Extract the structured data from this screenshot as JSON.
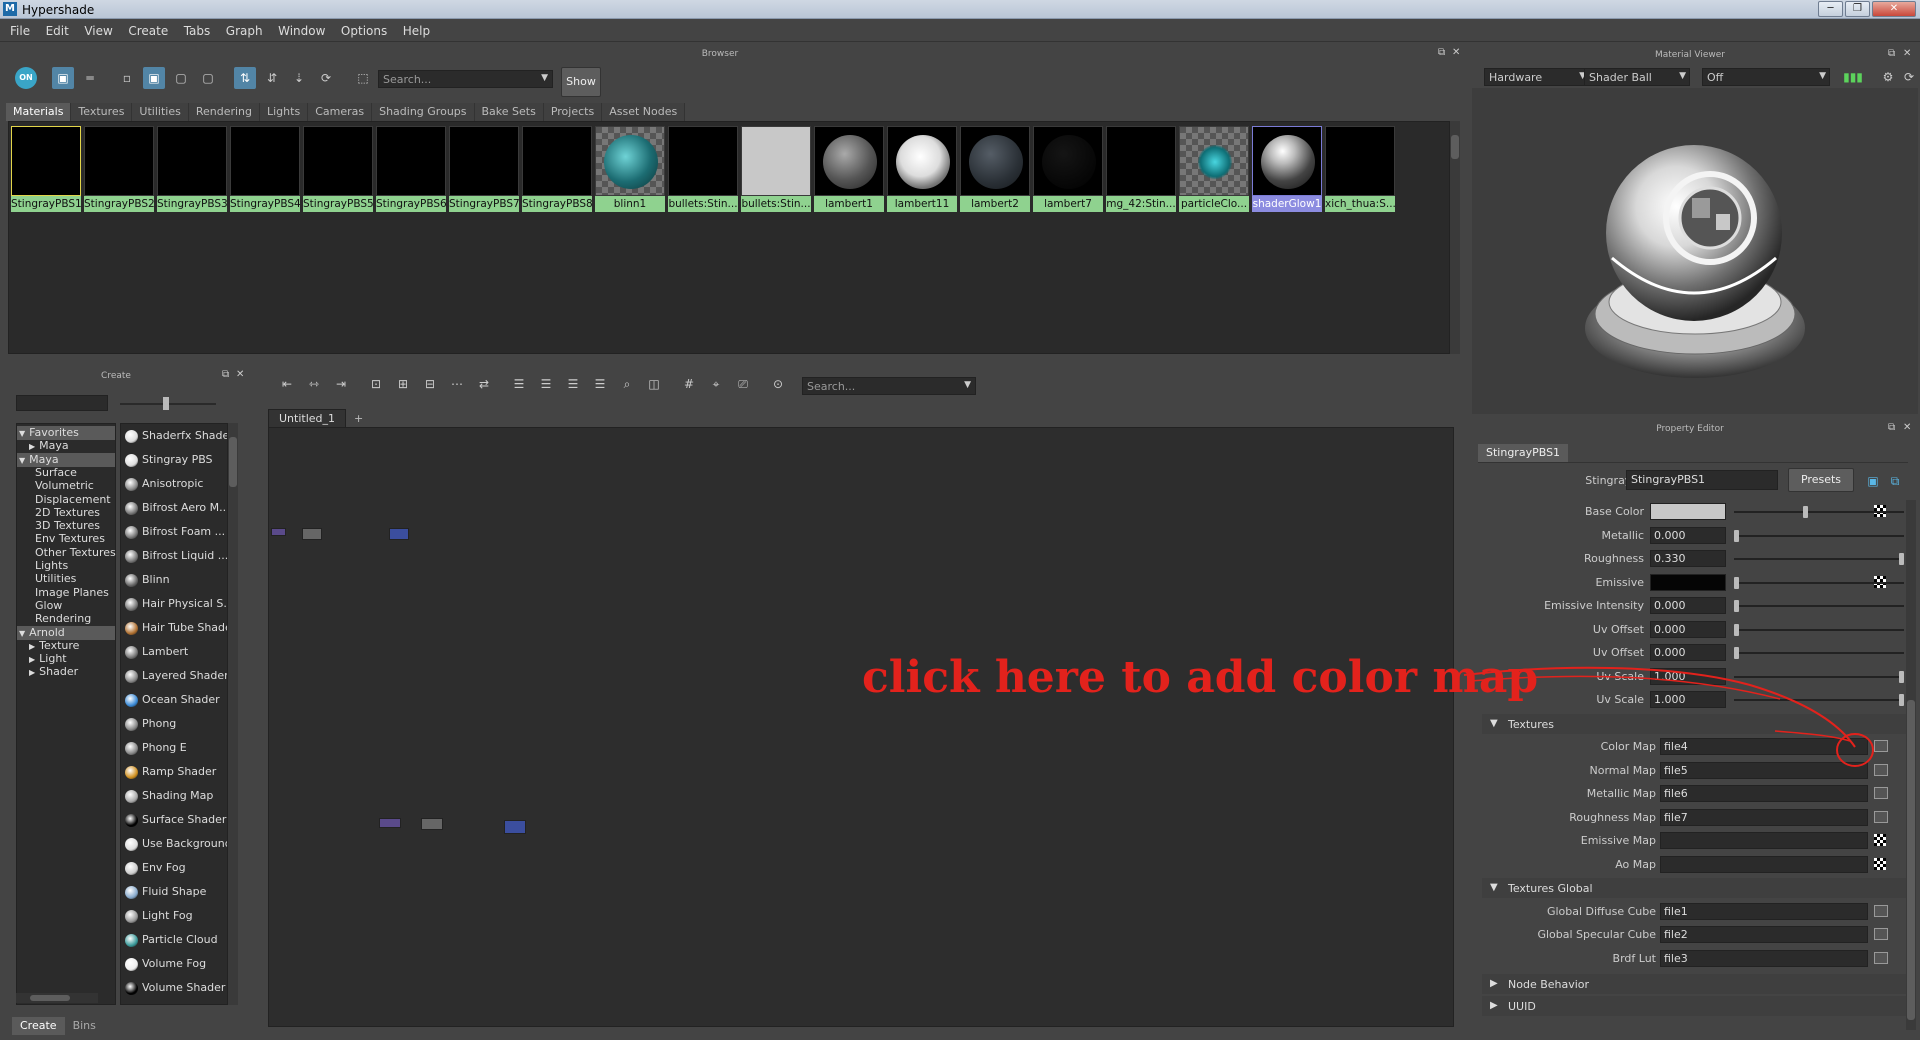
{
  "window": {
    "title": "Hypershade",
    "app_icon": "M",
    "controls": [
      "─",
      "❐",
      "✕"
    ]
  },
  "menubar": [
    "File",
    "Edit",
    "View",
    "Create",
    "Tabs",
    "Graph",
    "Window",
    "Options",
    "Help"
  ],
  "browser": {
    "label": "Browser",
    "search_placeholder": "Search...",
    "show_label": "Show",
    "toolbar_on": "ON",
    "tabs": [
      "Materials",
      "Textures",
      "Utilities",
      "Rendering",
      "Lights",
      "Cameras",
      "Shading Groups",
      "Bake Sets",
      "Projects",
      "Asset Nodes"
    ],
    "active_tab": "Materials",
    "swatches": [
      "StingrayPBS1",
      "StingrayPBS2",
      "StingrayPBS3",
      "StingrayPBS4",
      "StingrayPBS5",
      "StingrayPBS6",
      "StingrayPBS7",
      "StingrayPBS8",
      "blinn1",
      "bullets:Stin...",
      "bullets:Stin...",
      "lambert1",
      "lambert11",
      "lambert2",
      "lambert7",
      "mg_42:Stin...",
      "particleClo...",
      "shaderGlow1",
      "xich_thua:S..."
    ]
  },
  "material_viewer": {
    "label": "Material Viewer",
    "renderer": "Hardware",
    "geometry": "Shader Ball",
    "environment": "Off"
  },
  "create": {
    "label": "Create",
    "categories": [
      {
        "text": "Favorites",
        "level": 0,
        "expanded": true
      },
      {
        "text": "Maya",
        "level": 1,
        "expanded": false
      },
      {
        "text": "Maya",
        "level": 0,
        "expanded": true
      },
      {
        "text": "Surface",
        "level": 2
      },
      {
        "text": "Volumetric",
        "level": 2
      },
      {
        "text": "Displacement",
        "level": 2
      },
      {
        "text": "2D Textures",
        "level": 2
      },
      {
        "text": "3D Textures",
        "level": 2
      },
      {
        "text": "Env Textures",
        "level": 2
      },
      {
        "text": "Other Textures",
        "level": 2
      },
      {
        "text": "Lights",
        "level": 2
      },
      {
        "text": "Utilities",
        "level": 2
      },
      {
        "text": "Image Planes",
        "level": 2
      },
      {
        "text": "Glow",
        "level": 2
      },
      {
        "text": "Rendering",
        "level": 2
      },
      {
        "text": "Arnold",
        "level": 0,
        "expanded": true
      },
      {
        "text": "Texture",
        "level": 1,
        "expanded": false
      },
      {
        "text": "Light",
        "level": 1,
        "expanded": false
      },
      {
        "text": "Shader",
        "level": 1,
        "expanded": false
      }
    ],
    "nodes": [
      "Shaderfx Shader",
      "Stingray PBS",
      "Anisotropic",
      "Bifrost Aero M...",
      "Bifrost Foam ...",
      "Bifrost Liquid ...",
      "Blinn",
      "Hair Physical S...",
      "Hair Tube Shade",
      "Lambert",
      "Layered Shader",
      "Ocean Shader",
      "Phong",
      "Phong E",
      "Ramp Shader",
      "Shading Map",
      "Surface Shader",
      "Use Background",
      "Env Fog",
      "Fluid Shape",
      "Light Fog",
      "Particle Cloud",
      "Volume Fog",
      "Volume Shader"
    ],
    "bottom_tabs": [
      "Create",
      "Bins"
    ]
  },
  "graph": {
    "tab": "Untitled_1",
    "add_tab": "+",
    "search_placeholder": "Search..."
  },
  "property_editor": {
    "label": "Property Editor",
    "node_tab": "StingrayPBS1",
    "type_label": "StingrayPBS:",
    "node_name": "StingrayPBS1",
    "presets_label": "Presets",
    "attributes": [
      {
        "label": "Base Color",
        "kind": "color",
        "color": "#c8c8c8",
        "slider": 0.42
      },
      {
        "label": "Metallic",
        "value": "0.000",
        "slider": 0.0
      },
      {
        "label": "Roughness",
        "value": "0.330",
        "slider": 1.0
      },
      {
        "label": "Emissive",
        "kind": "color",
        "color": "#050505",
        "slider": 0.0
      },
      {
        "label": "Emissive Intensity",
        "value": "0.000",
        "slider": 0.0
      },
      {
        "label": "Uv Offset",
        "value": "0.000",
        "slider": 0.0
      },
      {
        "label": "Uv Offset",
        "value": "0.000",
        "slider": 0.0
      },
      {
        "label": "Uv Scale",
        "value": "1.000",
        "slider": 1.0
      },
      {
        "label": "Uv Scale",
        "value": "1.000",
        "slider": 1.0
      }
    ],
    "textures_header": "Textures",
    "textures": [
      {
        "label": "Color Map",
        "value": "file4",
        "button": "map"
      },
      {
        "label": "Normal Map",
        "value": "file5",
        "button": "map"
      },
      {
        "label": "Metallic Map",
        "value": "file6",
        "button": "map"
      },
      {
        "label": "Roughness Map",
        "value": "file7",
        "button": "map"
      },
      {
        "label": "Emissive Map",
        "value": "",
        "button": "checker"
      },
      {
        "label": "Ao Map",
        "value": "",
        "button": "checker"
      }
    ],
    "textures_global_header": "Textures Global",
    "textures_global": [
      {
        "label": "Global Diffuse Cube",
        "value": "file1"
      },
      {
        "label": "Global Specular Cube",
        "value": "file2"
      },
      {
        "label": "Brdf Lut",
        "value": "file3"
      }
    ],
    "collapsed_sections": [
      "Node Behavior",
      "UUID"
    ]
  },
  "annotation": {
    "text": "click here to add color map",
    "color": "#e3221c"
  }
}
